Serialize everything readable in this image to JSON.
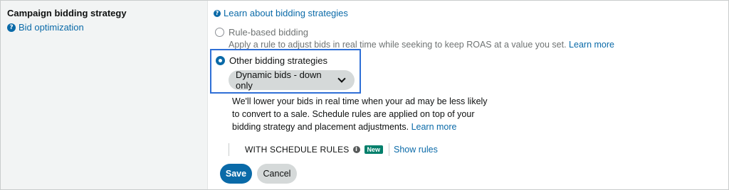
{
  "left": {
    "title": "Campaign bidding strategy",
    "help_link": "Bid optimization"
  },
  "learn_link": "Learn about bidding strategies",
  "options": {
    "rule_based": {
      "label": "Rule-based bidding",
      "description": "Apply a rule to adjust bids in real time while seeking to keep ROAS at a value you set.",
      "learn_more": "Learn more",
      "selected": false
    },
    "other": {
      "label": "Other bidding strategies",
      "selected": true,
      "dropdown_value": "Dynamic bids - down only",
      "description_line1": "We'll lower your bids in real time when your ad may be less likely",
      "description_line2": "to convert to a sale. Schedule rules are applied on top of your",
      "description_line3": "bidding strategy and placement adjustments.",
      "learn_more": "Learn more"
    }
  },
  "schedule": {
    "label": "WITH SCHEDULE RULES",
    "badge": "New",
    "show_rules": "Show rules"
  },
  "buttons": {
    "save": "Save",
    "cancel": "Cancel"
  },
  "colors": {
    "link": "#0a6aa8",
    "primary_button": "#0a6aa8",
    "highlight_border": "#2f6fd6",
    "new_badge": "#007f6b"
  },
  "icons": {
    "help": "question-circle-icon",
    "info": "info-circle-icon",
    "dropdown": "chevron-down-icon"
  }
}
